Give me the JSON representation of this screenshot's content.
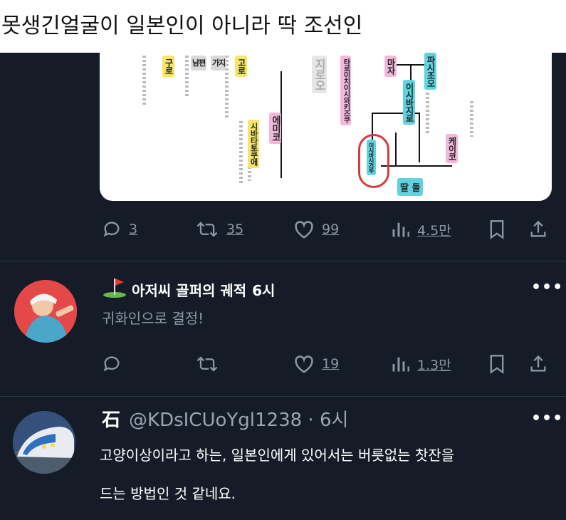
{
  "caption": "못생긴얼굴이 일본인이 아니라 딱 조선인",
  "tree_image": {
    "tags": [
      {
        "text": "구로",
        "color": "yellow"
      },
      {
        "text": "남편",
        "color": "gray"
      },
      {
        "text": "가지",
        "color": "gray"
      },
      {
        "text": "고로",
        "color": "yellow"
      },
      {
        "text": "지로오",
        "color": "faint"
      },
      {
        "text": "타로이치이시와키즈쿠",
        "color": "pink"
      },
      {
        "text": "마자",
        "color": "pink"
      },
      {
        "text": "파시조오",
        "color": "cyan"
      },
      {
        "text": "이시바지로",
        "color": "cyan"
      },
      {
        "text": "에미코",
        "color": "pink"
      },
      {
        "text": "시바타토쿠에",
        "color": "yellow"
      },
      {
        "text": "이시바시거루",
        "color": "cyan"
      },
      {
        "text": "케이코",
        "color": "pink"
      },
      {
        "text": "딸 둘",
        "color": "cyan"
      }
    ]
  },
  "tweet1_actions": {
    "reply": "3",
    "retweet": "35",
    "like": "99",
    "views": "4.5만"
  },
  "tweet2": {
    "name": "아저씨 골퍼의 궤적",
    "time": "6시",
    "text": "귀화인으로 결정!",
    "actions": {
      "reply": "",
      "retweet": "",
      "like": "19",
      "views": "1.3만"
    }
  },
  "tweet3": {
    "name": "石",
    "handle": "@KDsICUoYgl1238 · 6시",
    "text_line1": "고양이상이라고 하는, 일본인에게 있어서는 버릇없는 찻잔을",
    "text_line2": "드는 방법인 것 같네요."
  },
  "more_label": "•••",
  "colors": {
    "background": "#151c27",
    "muted": "#8b98a5",
    "text": "#ffffff"
  }
}
